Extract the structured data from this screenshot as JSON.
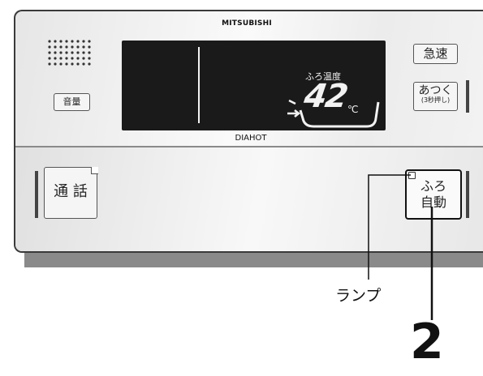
{
  "brand": "MITSUBISHI",
  "model": "DIAHOT",
  "display": {
    "temp_label": "ふろ温度",
    "temperature": "42",
    "unit": "℃"
  },
  "buttons": {
    "volume": "音量",
    "kyusoku": "急速",
    "atsuku": "あつく",
    "atsuku_sub": "(3秒押し)",
    "tsuwa": "通 話",
    "furo_line1": "ふろ",
    "furo_line2": "自動"
  },
  "callouts": {
    "lamp": "ランプ",
    "step": "2"
  },
  "colors": {
    "display_bg": "#1a1a1a",
    "display_fg": "#f2f2f2",
    "panel": "#eeeeee"
  }
}
